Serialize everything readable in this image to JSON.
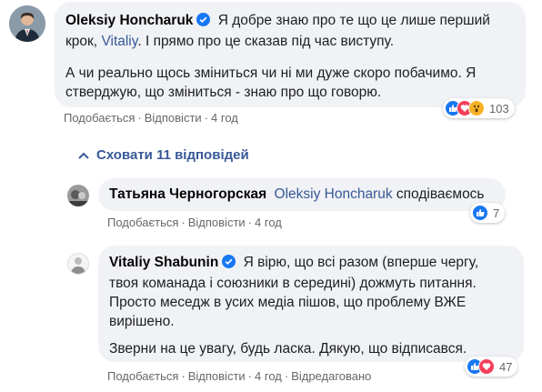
{
  "comment1": {
    "author": "Oleksiy Honcharuk",
    "mention": "Vitaliy",
    "para1_a": "Я добре знаю про те що це лише перший",
    "para1_b": "крок,",
    "para1_c": ". І прямо про це сказав під час виступу.",
    "para2_a": "А чи реально щось зміниться чи ні ми дуже скоро побачимо. Я",
    "para2_b": "стверджую, що зміниться - знаю про що говорю.",
    "like": "Подобається",
    "reply": "Відповісти",
    "time": "4 год",
    "reactions_count": "103"
  },
  "toggle": {
    "label": "Сховати 11 відповідей"
  },
  "comment2": {
    "author": "Татьяна Черногорская",
    "mention": "Oleksiy Honcharuk",
    "text": "сподіваємось",
    "like": "Подобається",
    "reply": "Відповісти",
    "time": "4 год",
    "reactions_count": "7"
  },
  "comment3": {
    "author": "Vitaliy Shabunin",
    "line1": "Я вірю, що всі разом (вперше чергу,",
    "line2": "твоя команада і союзники в середині) дожмуть питання.",
    "line3": "Просто меседж в усих медіа пішов, що проблему ВЖЕ",
    "line4": "вирішено.",
    "line5": "Зверни на це увагу, будь ласка. Дякую, що відписався.",
    "like": "Подобається",
    "reply": "Відповісти",
    "time": "4 год",
    "edited": "Відредаговано",
    "reactions_count": "47"
  },
  "colors": {
    "like_blue": "#1877f2",
    "love_red": "#f33e58",
    "wow_yellow": "#f7b125",
    "bubble": "#f0f2f5",
    "link_blue": "#385898"
  }
}
